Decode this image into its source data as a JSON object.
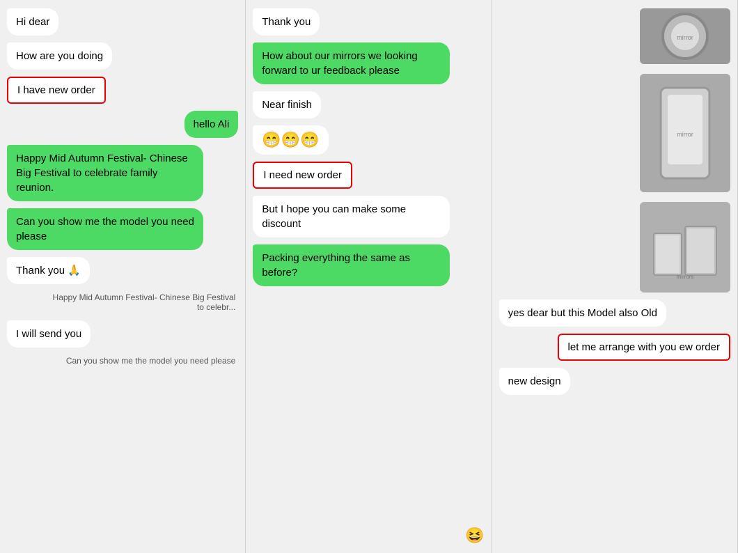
{
  "col1": {
    "messages": [
      {
        "type": "left",
        "text": "Hi dear"
      },
      {
        "type": "left",
        "text": "How are you doing"
      },
      {
        "type": "highlighted",
        "text": "I have new order"
      },
      {
        "type": "right",
        "text": "hello Ali"
      },
      {
        "type": "green-left",
        "text": "Happy Mid Autumn Festival- Chinese Big Festival to celebrate family reunion."
      },
      {
        "type": "green-left",
        "text": "Can you show me the model you need please"
      },
      {
        "type": "left",
        "text": "Thank you 🙏"
      },
      {
        "type": "caption",
        "text": "Happy Mid Autumn Festival- Chinese Big Festival to celebr..."
      },
      {
        "type": "left",
        "text": "I will send you"
      },
      {
        "type": "caption",
        "text": "Can you show me the model you need please"
      }
    ]
  },
  "col2": {
    "messages": [
      {
        "type": "left",
        "text": "Thank you"
      },
      {
        "type": "green-left",
        "text": "How about our mirrors we looking forward to ur feedback please"
      },
      {
        "type": "left",
        "text": "Near finish"
      },
      {
        "type": "emoji",
        "text": "😁😁😁"
      },
      {
        "type": "highlighted",
        "text": "I need new order"
      },
      {
        "type": "left",
        "text": "But I hope you can make some discount"
      },
      {
        "type": "green-left",
        "text": "Packing everything the same as before?"
      },
      {
        "type": "emoji-input",
        "text": "😆"
      }
    ]
  },
  "col3": {
    "messages": [
      {
        "type": "img-top-right",
        "label": "mirror circle image"
      },
      {
        "type": "img-mid-right",
        "label": "mirror tall image"
      },
      {
        "type": "img-bot-right",
        "label": "mirror shelf image"
      },
      {
        "type": "left",
        "text": "yes dear but this Model also Old"
      },
      {
        "type": "highlighted-right",
        "text": "let me arrange with you ew order"
      },
      {
        "type": "left",
        "text": "new design"
      }
    ]
  }
}
